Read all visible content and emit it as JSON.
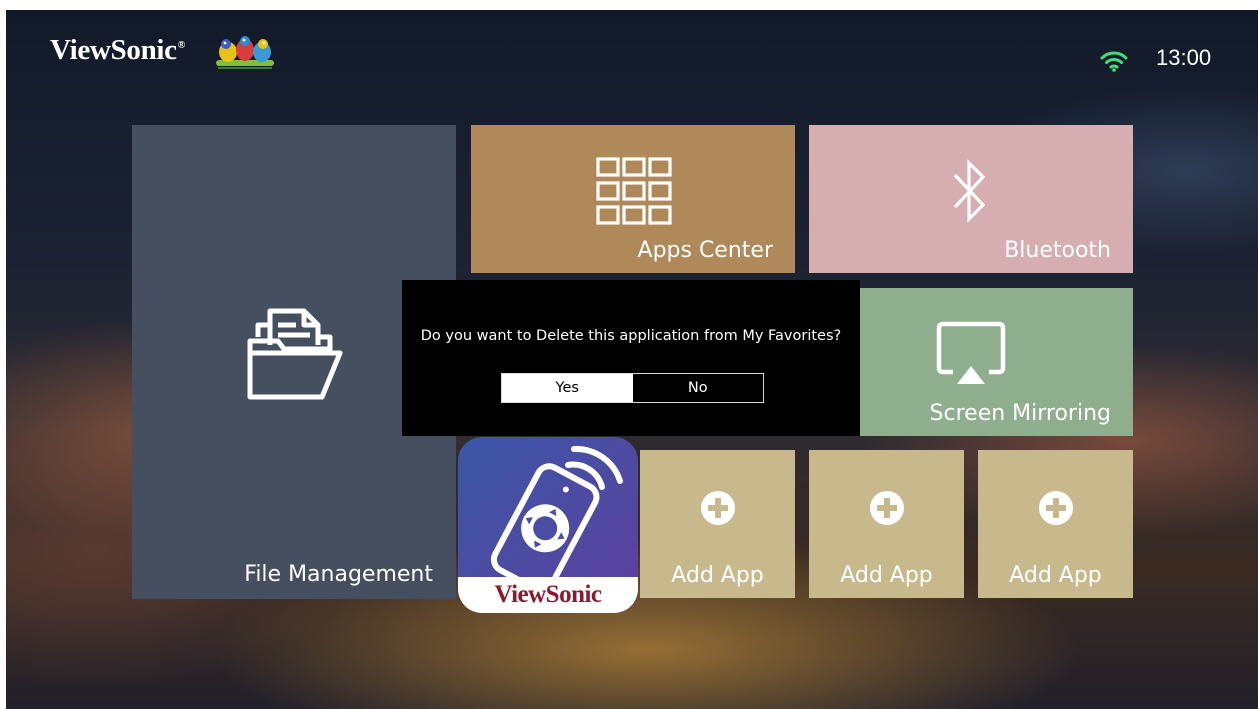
{
  "header": {
    "brand": "ViewSonic",
    "brand_mark": "®",
    "time": "13:00",
    "wifi_icon": "wifi-icon"
  },
  "tiles": {
    "file_management": {
      "label": "File Management",
      "icon": "folder-document-icon",
      "color": "#464f5f"
    },
    "apps_center": {
      "label": "Apps Center",
      "icon": "app-grid-icon",
      "color": "#b0895a"
    },
    "bluetooth": {
      "label": "Bluetooth",
      "icon": "bluetooth-icon",
      "color": "#d6adb1"
    },
    "screen_mirroring": {
      "label": "Screen Mirroring",
      "icon": "screen-mirroring-icon",
      "color": "#8fae8d"
    },
    "viewsonic_app": {
      "label": "ViewSonic",
      "icon": "remote-control-icon"
    },
    "add_apps": [
      {
        "label": "Add App",
        "icon": "plus-circle-icon"
      },
      {
        "label": "Add App",
        "icon": "plus-circle-icon"
      },
      {
        "label": "Add App",
        "icon": "plus-circle-icon"
      }
    ]
  },
  "dialog": {
    "message": "Do you want to Delete this application from My Favorites?",
    "yes_label": "Yes",
    "no_label": "No",
    "selected": "Yes"
  }
}
